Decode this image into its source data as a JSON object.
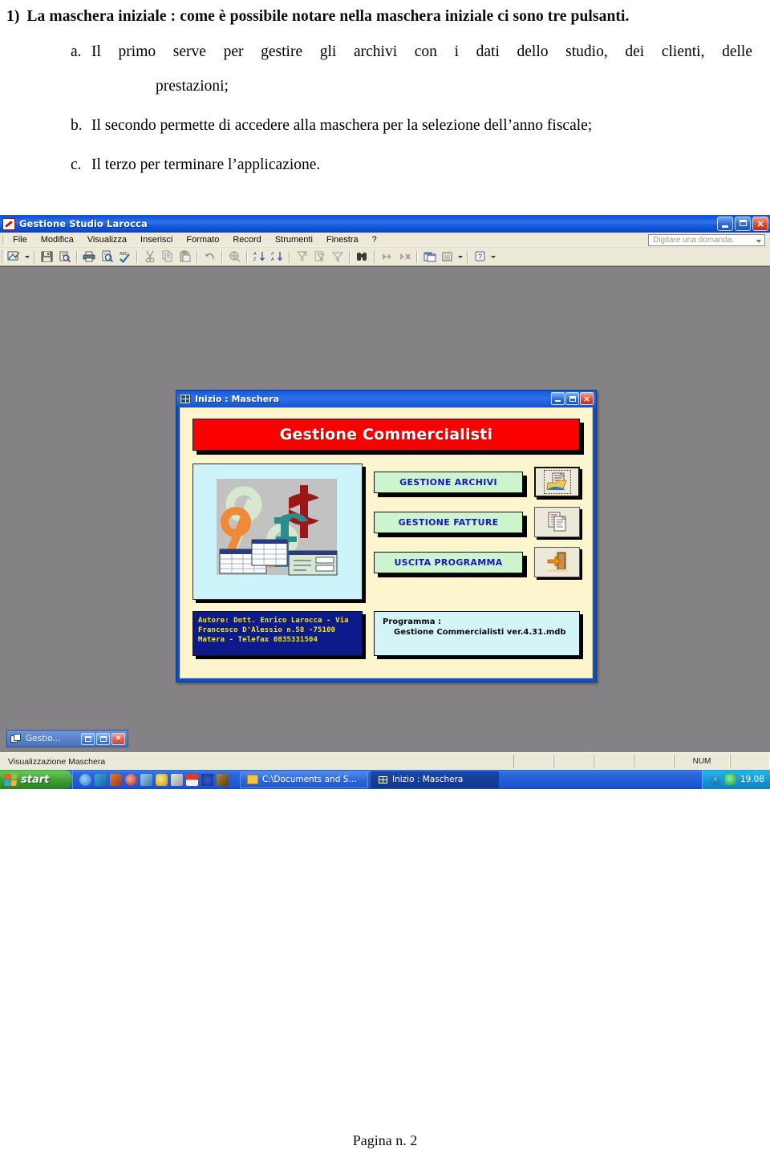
{
  "document": {
    "item_number": "1)",
    "item_text": "La maschera iniziale : come è possibile notare nella maschera iniziale ci sono tre pulsanti.",
    "sub_items": [
      {
        "letter": "a.",
        "text": "Il primo serve per gestire gli archivi con i dati dello studio, dei clienti, delle",
        "continuation": "prestazioni;"
      },
      {
        "letter": "b.",
        "text": "Il secondo permette di accedere alla maschera per la selezione dell’anno fiscale;",
        "continuation": ""
      },
      {
        "letter": "c.",
        "text": "Il terzo per terminare l’applicazione.",
        "continuation": ""
      }
    ],
    "footer": "Pagina n. 2"
  },
  "screenshot": {
    "app_window": {
      "title": "Gestione Studio Larocca",
      "icon": "access-key-icon",
      "controls": {
        "minimize": "minimize-icon",
        "restore": "restore-icon",
        "close": "×"
      },
      "menu": [
        {
          "label": "File",
          "accel": "F"
        },
        {
          "label": "Modifica",
          "accel": "M"
        },
        {
          "label": "Visualizza",
          "accel": "V"
        },
        {
          "label": "Inserisci",
          "accel": "I"
        },
        {
          "label": "Formato",
          "accel": "o"
        },
        {
          "label": "Record",
          "accel": "R"
        },
        {
          "label": "Strumenti",
          "accel": "S"
        },
        {
          "label": "Finestra",
          "accel": "n"
        },
        {
          "label": "?",
          "accel": ""
        }
      ],
      "ask_a_question": {
        "placeholder": "Digitare una domanda.",
        "value": ""
      },
      "toolbar_icons": [
        "view-design-icon",
        "save-icon",
        "search-file-icon",
        "print-icon",
        "print-preview-icon",
        "spelling-check-icon",
        "cut-icon",
        "copy-icon",
        "paste-icon",
        "undo-icon",
        "office-links-icon",
        "sort-ascending-icon",
        "sort-descending-icon",
        "filter-by-form-icon",
        "filter-by-selection-icon",
        "remove-filter-icon",
        "find-binoculars-icon",
        "new-record-icon",
        "delete-record-icon",
        "database-window-icon",
        "new-object-icon",
        "help-icon"
      ]
    },
    "form_window": {
      "title": "Inizio : Maschera",
      "icon": "form-grid-icon",
      "controls": {
        "minimize": "minimize-icon",
        "maximize": "maximize-icon",
        "close": "×"
      },
      "banner": "Gestione Commercialisti",
      "clipart": "finance-percent-currency-clipart",
      "buttons": [
        {
          "label": "GESTIONE ARCHIVI",
          "icon": "open-file-folder-icon",
          "focused": true
        },
        {
          "label": "GESTIONE FATTURE",
          "icon": "documents-copy-icon",
          "focused": false
        },
        {
          "label": "USCITA PROGRAMMA",
          "icon": "exit-door-arrow-icon",
          "focused": false
        }
      ],
      "author_box": [
        "Autore: Dott. Enrico Larocca - Via",
        "Francesco D'Alessio n.58 -75100",
        "Matera  -  Telefax 0835331504"
      ],
      "program_box": {
        "line1": "Programma :",
        "line2": "Gestione Commercialisti ver.4.31.mdb"
      }
    },
    "minimized_child": {
      "label": "Gestio...",
      "icon": "window-cascade-icon",
      "controls": {
        "restore": "restore-icon",
        "maximize": "maximize-icon",
        "close": "×"
      }
    },
    "status_bar": {
      "message": "Visualizzazione Maschera",
      "num_lock": "NUM"
    },
    "taskbar": {
      "start_label": "start",
      "quick_launch": [
        {
          "name": "internet-explorer-icon",
          "color": "#2a6fd6"
        },
        {
          "name": "outlook-express-icon",
          "color": "#2b8ccc"
        },
        {
          "name": "media-player-icon",
          "color": "#d85a2a"
        },
        {
          "name": "quicktime-icon",
          "color": "#b02222"
        },
        {
          "name": "show-desktop-icon",
          "color": "#4a9ad8"
        },
        {
          "name": "clock-app-icon",
          "color": "#e8c020"
        },
        {
          "name": "calculator-icon",
          "color": "#c8c8c8"
        },
        {
          "name": "news-app-icon",
          "color": "#d02020"
        },
        {
          "name": "europe-flag-icon",
          "color": "#1a3fa8"
        },
        {
          "name": "game-app-icon",
          "color": "#8a5a20"
        }
      ],
      "tasks": [
        {
          "label": "C:\\Documents and Se...",
          "icon": "folder-icon",
          "active": false
        },
        {
          "label": "Inizio : Maschera",
          "icon": "form-grid-icon",
          "active": true
        }
      ],
      "tray": {
        "expand": "‹",
        "icons": [
          {
            "name": "antivirus-icon",
            "color": "#2ad05a"
          },
          {
            "name": "network-icon",
            "color": "#d0d0d0"
          }
        ],
        "clock": "19.08"
      }
    }
  },
  "colors": {
    "title_blue": "#0f52d6",
    "banner_red": "#fb0000",
    "button_green": "#cdf5cc",
    "button_text_blue": "#1616c8",
    "form_cream": "#fdf5cd",
    "author_navy": "#0d1a8c",
    "author_yellow": "#f2e800",
    "program_cyan": "#d4f5f8",
    "workspace_gray": "#848284",
    "chrome_beige": "#ece9d8"
  }
}
